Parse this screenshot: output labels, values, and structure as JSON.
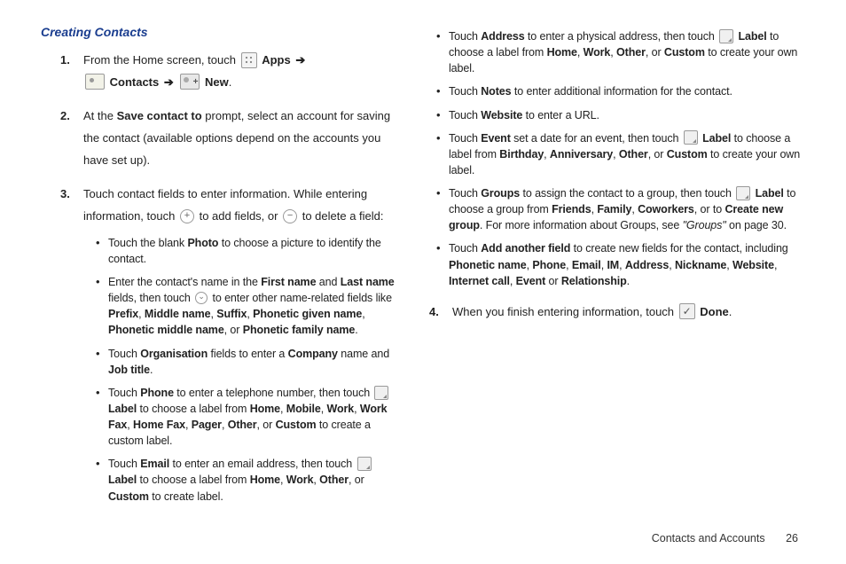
{
  "heading": "Creating Contacts",
  "steps": {
    "s1_a": "From the Home screen, touch ",
    "s1_apps": "Apps",
    "s1_contacts": "Contacts",
    "s1_new": "New",
    "s2_a": "At the ",
    "s2_b": "Save contact to",
    "s2_c": " prompt, select an account for saving the contact (available options depend on the accounts you have set up).",
    "s3_a": "Touch contact fields to enter information. While entering information, touch ",
    "s3_b": " to add fields, or ",
    "s3_c": " to delete a field:",
    "s4_a": "When you finish entering information, touch ",
    "s4_done": "Done"
  },
  "nums": {
    "n1": "1.",
    "n2": "2.",
    "n3": "3.",
    "n4": "4."
  },
  "arrow": "➔",
  "period": ".",
  "comma": ", ",
  "or": ", or ",
  "left_bullets": {
    "b1_a": "Touch the blank ",
    "b1_b": "Photo",
    "b1_c": " to choose a picture to identify the contact.",
    "b2_a": "Enter the contact's name in the ",
    "b2_b": "First name",
    "b2_c": " and ",
    "b2_d": "Last name",
    "b2_e": " fields, then touch ",
    "b2_f": " to enter other name-related fields like ",
    "b2_g": "Prefix",
    "b2_h": "Middle name",
    "b2_i": "Suffix",
    "b2_j": "Phonetic given name",
    "b2_k": "Phonetic middle name",
    "b2_l": "Phonetic family name",
    "b3_a": "Touch ",
    "b3_b": "Organisation",
    "b3_c": " fields to enter a ",
    "b3_d": "Company",
    "b3_e": " name and ",
    "b3_f": "Job title",
    "b4_a": "Touch ",
    "b4_b": "Phone",
    "b4_c": " to enter a telephone number, then touch ",
    "b4_d": "Label",
    "b4_e": " to choose a label from ",
    "b4_f": "Home",
    "b4_g": "Mobile",
    "b4_h": "Work",
    "b4_i": "Work Fax",
    "b4_j": "Home Fax",
    "b4_k": "Pager",
    "b4_l": "Other",
    "b4_m": "Custom",
    "b4_n": " to create a custom label.",
    "b5_a": "Touch ",
    "b5_b": "Email",
    "b5_c": " to enter an email address, then touch ",
    "b5_d": "Label",
    "b5_e": " to choose a label from ",
    "b5_f": "Home",
    "b5_g": "Work",
    "b5_h": "Other",
    "b5_i": "Custom",
    "b5_j": "  to create label."
  },
  "right_bullets": {
    "r1_a": "Touch ",
    "r1_b": "Address",
    "r1_c": " to enter a physical address, then touch ",
    "r1_d": "Label",
    "r1_e": " to choose a label from ",
    "r1_f": "Home",
    "r1_g": "Work",
    "r1_h": "Other",
    "r1_i": "Custom",
    "r1_j": " to create your own label.",
    "r2_a": "Touch ",
    "r2_b": "Notes",
    "r2_c": " to enter additional information for the contact.",
    "r3_a": "Touch ",
    "r3_b": "Website",
    "r3_c": " to enter a URL.",
    "r4_a": "Touch ",
    "r4_b": "Event",
    "r4_c": " set a date for an event, then touch ",
    "r4_d": "Label",
    "r4_e": " to choose a label from ",
    "r4_f": "Birthday",
    "r4_g": "Anniversary",
    "r4_h": "Other",
    "r4_i": "Custom",
    "r4_j": "  to create your own label.",
    "r5_a": "Touch ",
    "r5_b": "Groups",
    "r5_c": " to assign the contact to a group, then touch ",
    "r5_d": "Label",
    "r5_e": " to choose a group from ",
    "r5_f": "Friends",
    "r5_g": "Family",
    "r5_h": "Coworkers",
    "r5_i": ", or to ",
    "r5_j": "Create new group",
    "r5_k": ". For more information about Groups, see ",
    "r5_l": "\"Groups\"",
    "r5_m": " on page 30.",
    "r6_a": "Touch ",
    "r6_b": "Add another field",
    "r6_c": " to create new fields for the contact, including ",
    "r6_d": "Phonetic name",
    "r6_e": "Phone",
    "r6_f": "Email",
    "r6_g": "IM",
    "r6_h": "Address",
    "r6_i": "Nickname",
    "r6_j": "Website",
    "r6_k": "Internet call",
    "r6_l": "Event",
    "r6_m": " or ",
    "r6_n": "Relationship"
  },
  "footer": {
    "section": "Contacts and Accounts",
    "page": "26"
  }
}
